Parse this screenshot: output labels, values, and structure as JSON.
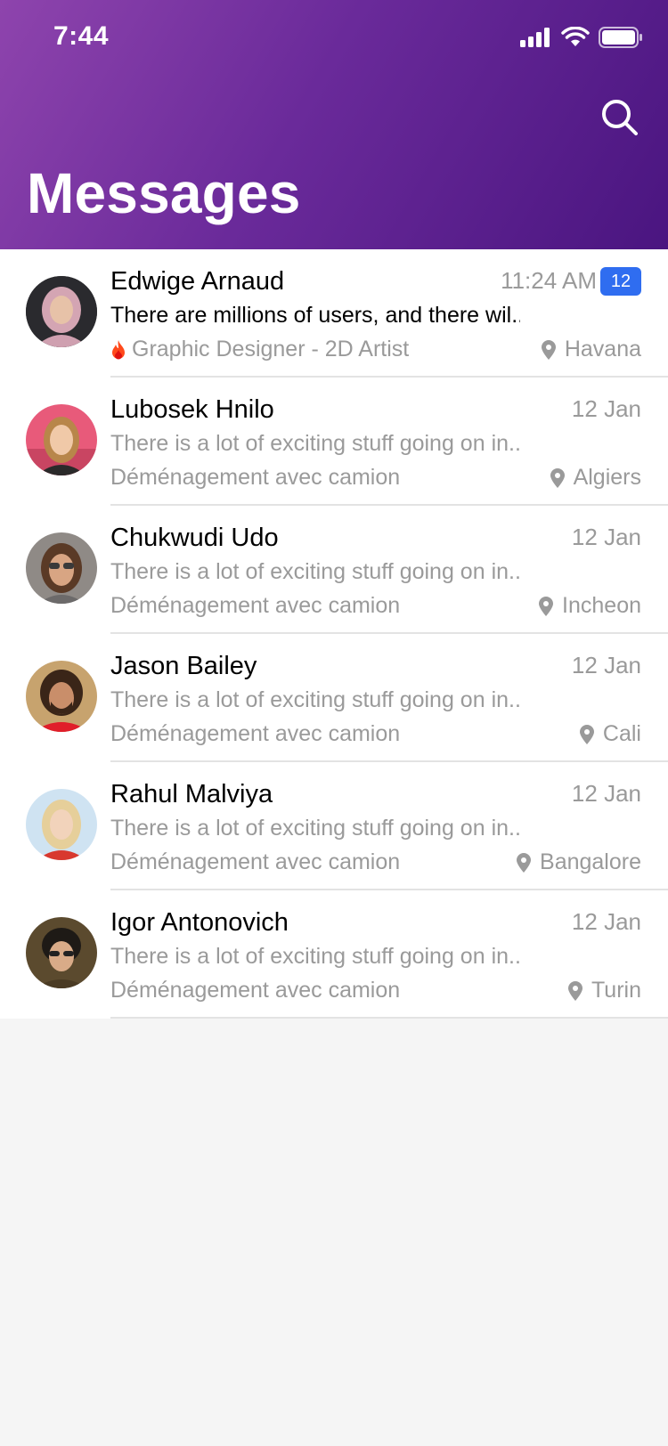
{
  "status_bar": {
    "time": "7:44"
  },
  "header": {
    "title": "Messages"
  },
  "colors": {
    "header_start": "#8e44ad",
    "header_end": "#4a1580",
    "badge": "#2f6df0"
  },
  "conversations": [
    {
      "name": "Edwige Arnaud",
      "time": "11:24 AM",
      "badge": "12",
      "preview": "There are millions of users, and there wil...",
      "subtitle": "Graphic Designer - 2D Artist",
      "location": "Havana"
    },
    {
      "name": "Lubosek Hnilo",
      "time": "12 Jan",
      "preview": "There is a lot of exciting stuff going on in...",
      "subtitle": "Déménagement avec camion",
      "location": "Algiers"
    },
    {
      "name": "Chukwudi Udo",
      "time": "12 Jan",
      "preview": "There is a lot of exciting stuff going on in...",
      "subtitle": "Déménagement avec camion",
      "location": "Incheon"
    },
    {
      "name": "Jason Bailey",
      "time": "12 Jan",
      "preview": "There is a lot of exciting stuff going on in...",
      "subtitle": "Déménagement avec camion",
      "location": "Cali"
    },
    {
      "name": "Rahul Malviya",
      "time": "12 Jan",
      "preview": "There is a lot of exciting stuff going on in...",
      "subtitle": "Déménagement avec camion",
      "location": "Bangalore"
    },
    {
      "name": "Igor Antonovich",
      "time": "12 Jan",
      "preview": "There is a lot of exciting stuff going on in...",
      "subtitle": "Déménagement avec camion",
      "location": "Turin"
    }
  ]
}
